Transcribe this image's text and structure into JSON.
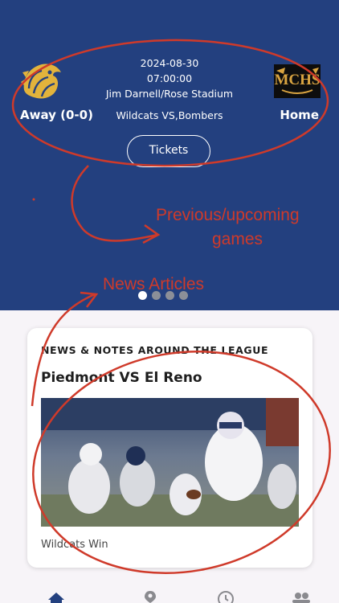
{
  "game": {
    "date": "2024-08-30",
    "time": "07:00:00",
    "venue": "Jim Darnell/Rose Stadium",
    "away_label": "Away (0-0)",
    "home_label": "Home",
    "matchup": "Wildcats VS,Bombers",
    "tickets_label": "Tickets"
  },
  "home_logo_text": "MCHS",
  "carousel": {
    "count": 4,
    "active": 0
  },
  "annotations": {
    "games_line1": "Previous/upcoming",
    "games_line2": "games",
    "news": "News Articles"
  },
  "news_card": {
    "kicker": "NEWS & NOTES AROUND THE LEAGUE",
    "title": "Piedmont VS El Reno",
    "caption": "Wildcats Win"
  },
  "tabbar": {
    "icons": [
      "home-icon",
      "location-pin-icon",
      "clock-icon",
      "people-icon"
    ],
    "active": "home-icon"
  },
  "colors": {
    "hero_bg": "#23407f",
    "annotation": "#cf3a2a",
    "page_bg": "#f7f4f8"
  }
}
